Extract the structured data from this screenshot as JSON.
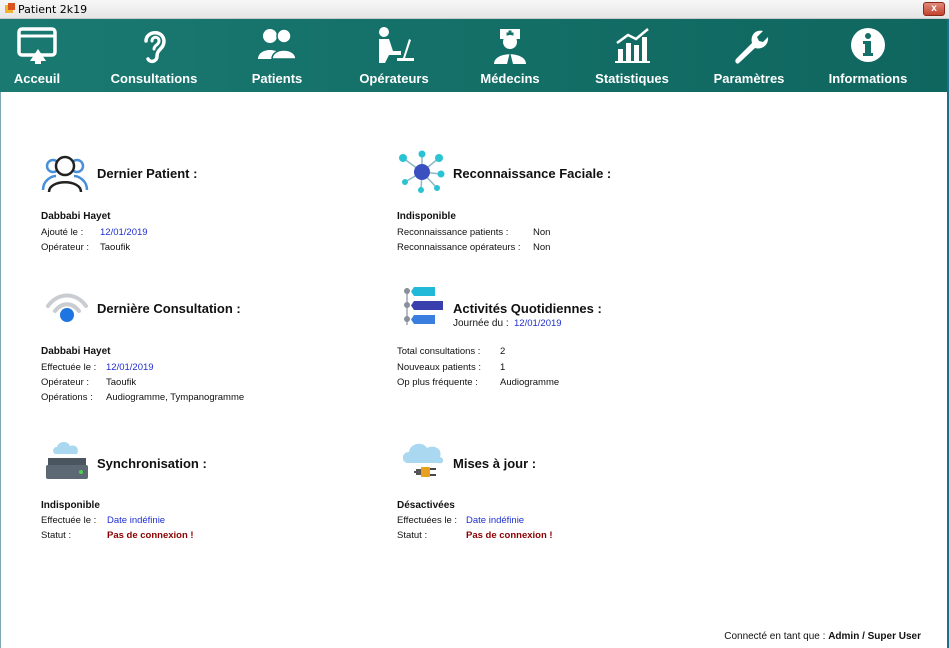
{
  "window": {
    "title": "Patient 2k19",
    "close_label": "x"
  },
  "toolbar": {
    "items": [
      {
        "label": "Acceuil",
        "icon": "home-screen-icon"
      },
      {
        "label": "Consultations",
        "icon": "ear-icon"
      },
      {
        "label": "Patients",
        "icon": "users-icon"
      },
      {
        "label": "Opérateurs",
        "icon": "operator-desk-icon"
      },
      {
        "label": "Médecins",
        "icon": "doctor-icon"
      },
      {
        "label": "Statistiques",
        "icon": "chart-icon"
      },
      {
        "label": "Paramètres",
        "icon": "wrench-icon"
      },
      {
        "label": "Informations",
        "icon": "info-icon"
      }
    ]
  },
  "panels": {
    "dernier_patient": {
      "title": "Dernier Patient :",
      "name": "Dabbabi Hayet",
      "rows": [
        {
          "label": "Ajouté le :",
          "value": "12/01/2019"
        },
        {
          "label": "Opérateur :",
          "value": "Taoufik"
        }
      ]
    },
    "reconnaissance": {
      "title": "Reconnaissance Faciale :",
      "status": "Indisponible",
      "rows": [
        {
          "label": "Reconnaissance patients :",
          "value": "Non"
        },
        {
          "label": "Reconnaissance opérateurs :",
          "value": "Non"
        }
      ]
    },
    "derniere_consultation": {
      "title": "Dernière Consultation :",
      "name": "Dabbabi Hayet",
      "rows": [
        {
          "label": "Effectuée le :",
          "value": "12/01/2019"
        },
        {
          "label": "Opérateur :",
          "value": "Taoufik"
        },
        {
          "label": "Opérations :",
          "value": "Audiogramme, Tympanogramme"
        }
      ]
    },
    "activites": {
      "title": "Activités Quotidiennes :",
      "subtitle_label": "Journée du :",
      "subtitle_value": "12/01/2019",
      "rows": [
        {
          "label": "Total consultations :",
          "value": "2"
        },
        {
          "label": "Nouveaux patients :",
          "value": "1"
        },
        {
          "label": "Op plus fréquente :",
          "value": "Audiogramme"
        }
      ]
    },
    "synchronisation": {
      "title": "Synchronisation :",
      "status": "Indisponible",
      "rows": [
        {
          "label": "Effectuée le :",
          "value": "Date indéfinie"
        },
        {
          "label": "Statut :",
          "value": "Pas de connexion !"
        }
      ]
    },
    "mises_a_jour": {
      "title": "Mises à jour :",
      "status": "Désactivées",
      "rows": [
        {
          "label": "Effectuées le :",
          "value": "Date indéfinie"
        },
        {
          "label": "Statut :",
          "value": "Pas de connexion !"
        }
      ]
    }
  },
  "footer": {
    "label": "Connecté en tant que :",
    "user": "Admin / Super User"
  },
  "colors": {
    "toolbar": "#147068",
    "link_blue": "#1f2fd0",
    "error_red": "#8b0000"
  }
}
